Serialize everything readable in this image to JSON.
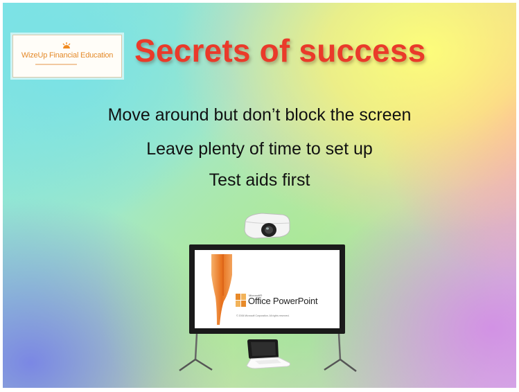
{
  "logo": {
    "name": "WizeUp Financial Education",
    "icon": "sun-logo-icon"
  },
  "title": "Secrets of success",
  "bullets": [
    "Move around but don’t block the screen",
    "Leave plenty of time to set up",
    "Test aids first"
  ],
  "screen": {
    "microsoft_label": "Microsoft®",
    "product_name": "Office PowerPoint",
    "copyright": "© 2006 Microsoft Corporation. All rights reserved."
  },
  "icons": {
    "projector": "projector-icon",
    "screen": "projection-screen-icon",
    "laptop": "laptop-icon"
  },
  "colors": {
    "title": "#ea3a2a",
    "text": "#111111",
    "logo_text": "#e48a2a"
  }
}
